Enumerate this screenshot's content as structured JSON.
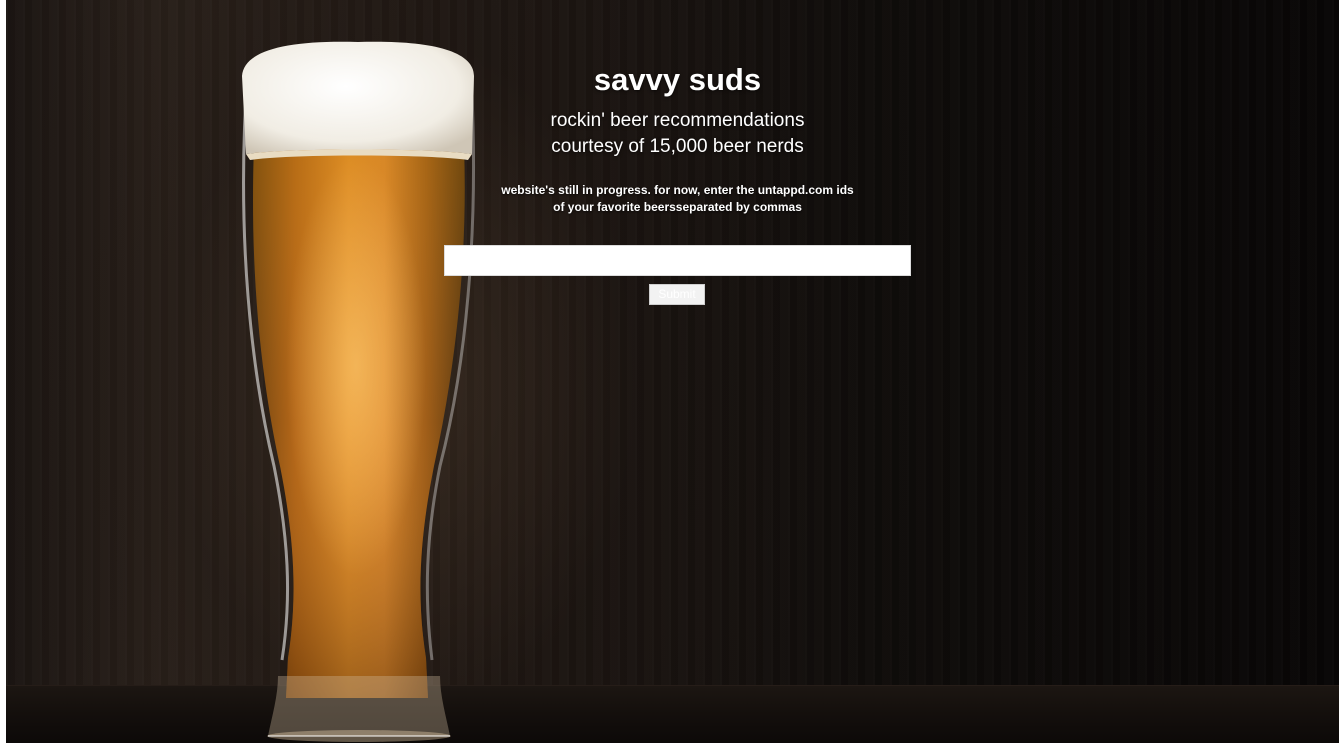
{
  "hero": {
    "title": "savvy suds",
    "tagline_line1": "rockin' beer recommendations",
    "tagline_line2": "courtesy of 15,000 beer nerds",
    "instructions_line1": "website's still in progress. for now, enter the untappd.com ids",
    "instructions_line2": "of your favorite beersseparated by commas"
  },
  "form": {
    "input_value": "",
    "input_placeholder": "",
    "submit_label": "Submit"
  },
  "colors": {
    "text": "#ffffff",
    "background": "#0f0c0a",
    "beer": "#c9781c",
    "foam": "#f4f1ea"
  },
  "images": {
    "background": "beer-glass-photo"
  }
}
